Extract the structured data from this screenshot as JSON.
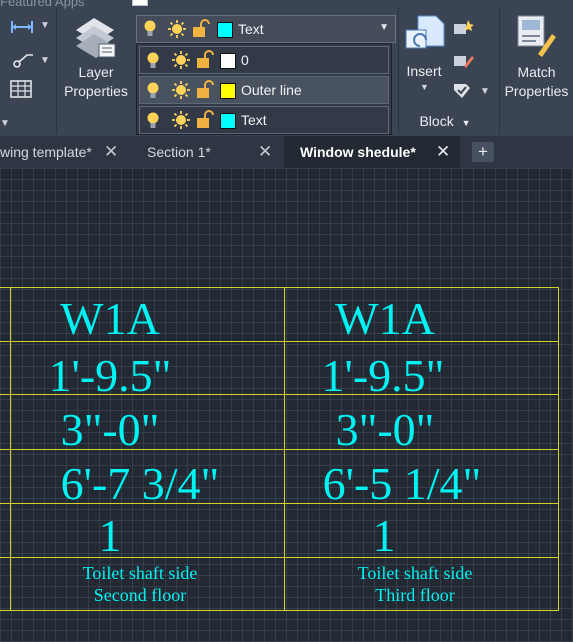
{
  "ribbon": {
    "featured_apps_label": "Featured Apps",
    "layer_properties_label": [
      "Layer",
      "Properties"
    ],
    "insert_label": "Insert",
    "block_label": "Block",
    "match_properties_label": [
      "Match",
      "Properties"
    ]
  },
  "layer_dropdown": {
    "current": {
      "name": "Text",
      "color": "#00ffff"
    },
    "layers": [
      {
        "name": "0",
        "color": "#ffffff"
      },
      {
        "name": "Outer line",
        "color": "#ffff00"
      },
      {
        "name": "Text",
        "color": "#00ffff"
      }
    ]
  },
  "tabs": [
    {
      "label": "wing template*",
      "active": false
    },
    {
      "label": "Section 1*",
      "active": false
    },
    {
      "label": "Window shedule*",
      "active": true
    }
  ],
  "table": {
    "columns": [
      {
        "id": "W1A",
        "width": "1'-9.5\"",
        "height": "3\"-0\"",
        "sill": "6'-7 3/4\"",
        "qty": "1",
        "note_line1": "Toilet shaft side",
        "note_line2": "Second floor"
      },
      {
        "id": "W1A",
        "width": "1'-9.5\"",
        "height": "3\"-0\"",
        "sill": "6'-5 1/4\"",
        "qty": "1",
        "note_line1": "Toilet shaft side",
        "note_line2": "Third floor"
      }
    ]
  },
  "colors": {
    "ribbon_bg": "#3b4453",
    "canvas_bg": "#222933",
    "table_line": "#d4cf2c",
    "text_layer": "#00f2f2"
  }
}
